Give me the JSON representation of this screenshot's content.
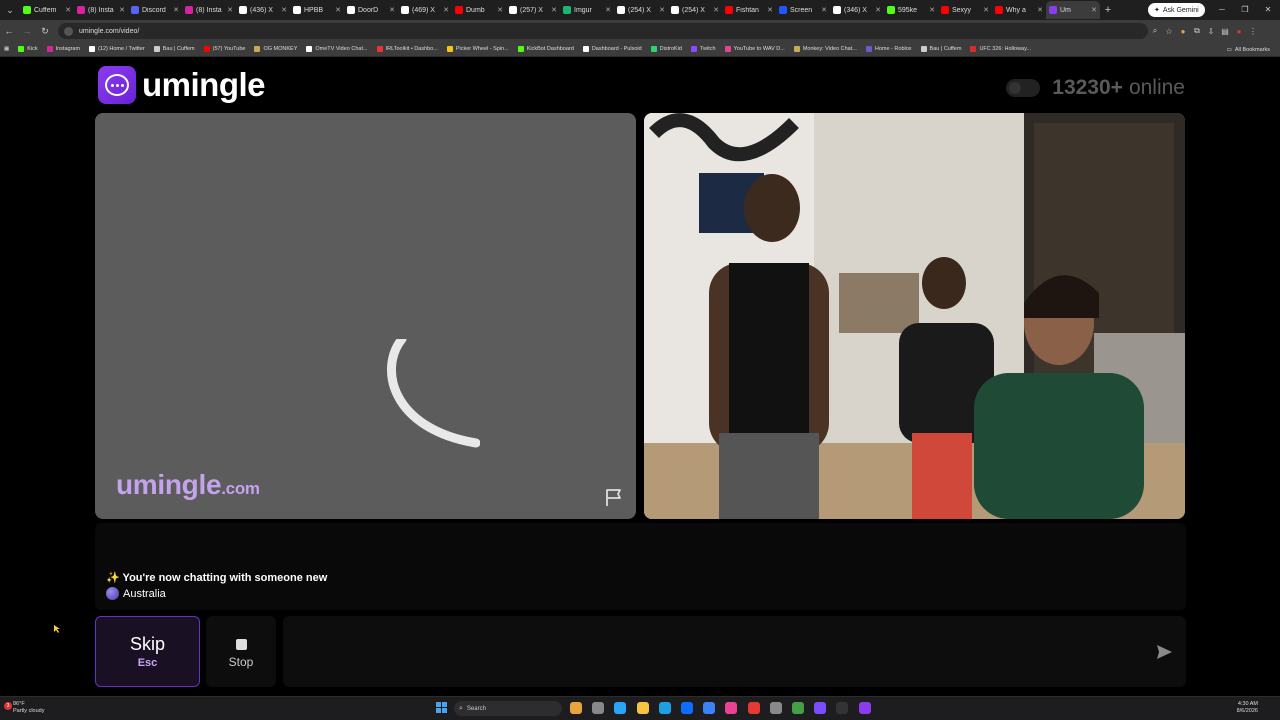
{
  "browser": {
    "tabs": [
      {
        "label": "Cuffem",
        "color": "#53fc18"
      },
      {
        "label": "(8) Insta",
        "color": "#d6249f"
      },
      {
        "label": "Discord",
        "color": "#5865f2"
      },
      {
        "label": "(8) Insta",
        "color": "#d6249f"
      },
      {
        "label": "(436) X",
        "color": "#ffffff"
      },
      {
        "label": "HPBB",
        "color": "#ffffff"
      },
      {
        "label": "DoorD",
        "color": "#ffffff"
      },
      {
        "label": "(469) X",
        "color": "#ffffff"
      },
      {
        "label": "Dumb",
        "color": "#ff0000"
      },
      {
        "label": "(257) X",
        "color": "#ffffff"
      },
      {
        "label": "Imgur",
        "color": "#1bb76e"
      },
      {
        "label": "(254) X",
        "color": "#ffffff"
      },
      {
        "label": "(254) X",
        "color": "#ffffff"
      },
      {
        "label": "Fishtan",
        "color": "#ff0000"
      },
      {
        "label": "Screen",
        "color": "#2255ff"
      },
      {
        "label": "(346) X",
        "color": "#ffffff"
      },
      {
        "label": "595ke",
        "color": "#53fc18"
      },
      {
        "label": "Sexyy",
        "color": "#ff0000"
      },
      {
        "label": "Why a",
        "color": "#ff0000"
      },
      {
        "label": "Um",
        "color": "#8b3cf0",
        "active": true
      }
    ],
    "ask_gemini_label": "Ask Gemini",
    "url": "umingle.com/video/",
    "bookmarks": [
      {
        "label": "Kick",
        "color": "#53fc18"
      },
      {
        "label": "Instagram",
        "color": "#d6249f"
      },
      {
        "label": "(12) Home / Twitter",
        "color": "#ffffff"
      },
      {
        "label": "Bau | Cuffem",
        "color": "#cccccc"
      },
      {
        "label": "(57) YouTube",
        "color": "#ff0000"
      },
      {
        "label": "OG MONKEY",
        "color": "#c8a85a"
      },
      {
        "label": "OmeTV Video Chat...",
        "color": "#ffffff"
      },
      {
        "label": "IRLToolkit • Dashbo...",
        "color": "#e33"
      },
      {
        "label": "Picker Wheel - Spin...",
        "color": "#f5c518"
      },
      {
        "label": "KickBot Dashboard",
        "color": "#53fc18"
      },
      {
        "label": "Dashboard - Pulsoid",
        "color": "#ffffff"
      },
      {
        "label": "DistroKid",
        "color": "#2dd36f"
      },
      {
        "label": "Twitch",
        "color": "#9146ff"
      },
      {
        "label": "YouTube to WAV D...",
        "color": "#e84393"
      },
      {
        "label": "Monkey: Video Chat...",
        "color": "#c8a85a"
      },
      {
        "label": "Home - Roblox",
        "color": "#6a5acd"
      },
      {
        "label": "Bau | Cuffem",
        "color": "#cccccc"
      },
      {
        "label": "UFC 326: Holloway...",
        "color": "#d32f2f"
      }
    ],
    "all_bookmarks_label": "All Bookmarks"
  },
  "page": {
    "logo_text": "umingle",
    "online_count": "13230+",
    "online_label": "online",
    "watermark_main": "umingle",
    "watermark_suffix": ".com",
    "chat": {
      "message": "✨ You're now chatting with someone new",
      "location": "Australia"
    },
    "skip_label": "Skip",
    "skip_key": "Esc",
    "stop_label": "Stop",
    "message_placeholder": ""
  },
  "taskbar": {
    "temperature": "86°F",
    "weather": "Partly cloudy",
    "search_label": "Search",
    "time": "4:30 AM",
    "date": "8/6/2026",
    "apps": [
      "#e8a33d",
      "#888888",
      "#2aa4f4",
      "#f6c343",
      "#1fa0e0",
      "#0d6efd",
      "#3b82f6",
      "#e84393",
      "#e53935",
      "#8a8a8a",
      "#43a047",
      "#7c4dff",
      "#333333",
      "#8b3cf0"
    ]
  }
}
